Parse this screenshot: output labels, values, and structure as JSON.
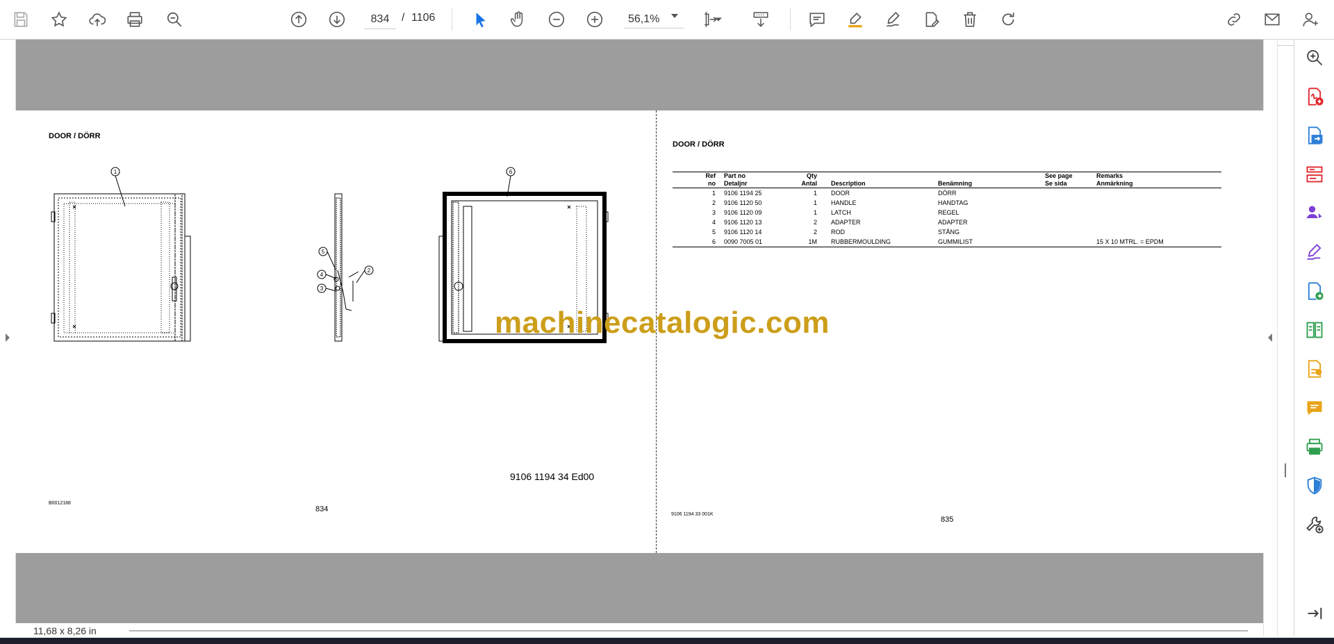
{
  "toolbar": {
    "icons": [
      "save-icon",
      "bookmark-star-icon",
      "upload-cloud-icon",
      "print-icon",
      "find-icon",
      "page-up-icon",
      "page-down-icon",
      "select-cursor-icon",
      "hand-pan-icon",
      "zoom-out-icon",
      "zoom-in-icon",
      "fit-page-icon",
      "scroll-mode-icon",
      "comment-icon",
      "highlight-icon",
      "draw-icon",
      "fill-sign-icon",
      "delete-icon",
      "rotate-icon",
      "share-link-icon",
      "email-icon",
      "account-icon"
    ],
    "current_page": "834",
    "page_separator": "/",
    "total_pages": "1106",
    "zoom": "56,1%"
  },
  "sidebar": {
    "icons": [
      "search-zoom-icon",
      "create-pdf-icon",
      "export-pdf-icon",
      "organize-pages-icon",
      "request-signature-icon",
      "fill-and-sign-icon",
      "send-for-review-icon",
      "compare-files-icon",
      "combine-files-icon",
      "add-comment-icon",
      "print-production-icon",
      "protect-icon",
      "more-tools-icon",
      "expand-panel-icon"
    ]
  },
  "document": {
    "left_page": {
      "title": "DOOR / DÖRR",
      "drawing_number": "9106 1194 34  Ed00",
      "image_ref": "B0012188",
      "page_number": "834",
      "callouts": [
        "1",
        "5",
        "4",
        "3",
        "2",
        "6"
      ]
    },
    "right_page": {
      "title": "DOOR / DÖRR",
      "table": {
        "headers": {
          "ref": [
            "Ref",
            "no"
          ],
          "part": [
            "Part no",
            "Detaljnr"
          ],
          "qty": [
            "Qty",
            "Antal"
          ],
          "desc": [
            "Description",
            ""
          ],
          "ben": [
            "Benämning",
            ""
          ],
          "see": [
            "See page",
            "Se sida"
          ],
          "rem": [
            "Remarks",
            "Anmärkning"
          ]
        },
        "rows": [
          {
            "ref": "1",
            "part": "9106 1194 25",
            "qty": "1",
            "desc": "DOOR",
            "ben": "DÖRR",
            "see": "",
            "rem": ""
          },
          {
            "ref": "2",
            "part": "9106 1120 50",
            "qty": "1",
            "desc": "HANDLE",
            "ben": "HANDTAG",
            "see": "",
            "rem": ""
          },
          {
            "ref": "3",
            "part": "9106 1120 09",
            "qty": "1",
            "desc": "LATCH",
            "ben": "REGEL",
            "see": "",
            "rem": ""
          },
          {
            "ref": "4",
            "part": "9106 1120 13",
            "qty": "2",
            "desc": "ADAPTER",
            "ben": "ADAPTER",
            "see": "",
            "rem": ""
          },
          {
            "ref": "5",
            "part": "9106 1120 14",
            "qty": "2",
            "desc": "ROD",
            "ben": "STÅNG",
            "see": "",
            "rem": ""
          },
          {
            "ref": "6",
            "part": "0090 7005 01",
            "qty": "1M",
            "desc": "RUBBERMOULDING",
            "ben": "GUMMILIST",
            "see": "",
            "rem": "15 X 10    MTRL. = EPDM"
          }
        ]
      },
      "doc_code": "9106 1194 33  001K",
      "page_number": "835"
    },
    "watermark": "machinecatalogic.com"
  },
  "status": {
    "page_size": "11,68 x 8,26 in"
  },
  "colors": {
    "viewer_bg": "#9d9d9d",
    "accent_blue": "#1473e6",
    "sidebar_red": "#e0282e",
    "sidebar_purple": "#7d3fd6",
    "sidebar_blue": "#2d7fd6",
    "sidebar_green": "#2e9e4f",
    "sidebar_yellow": "#e8a317",
    "watermark": "#cc9e1a"
  }
}
